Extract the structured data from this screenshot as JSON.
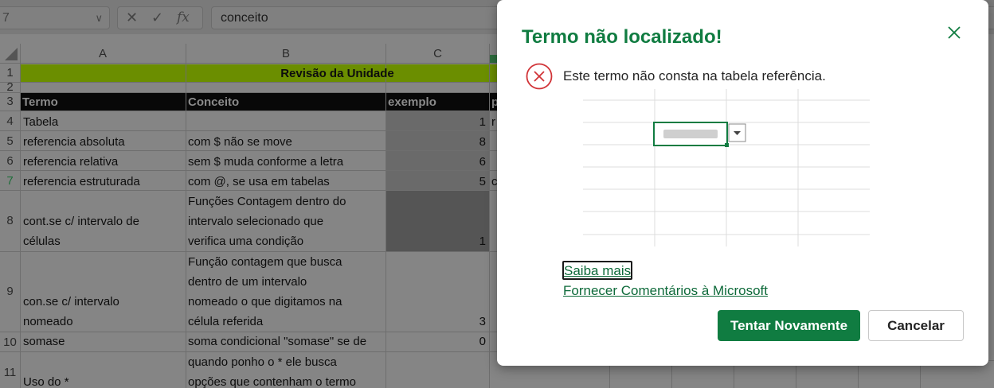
{
  "formula_bar": {
    "name_box_value": "7",
    "cancel_symbol": "✕",
    "enter_symbol": "✓",
    "function_symbol": "fx",
    "formula_text": "conceito"
  },
  "sheet": {
    "columns": [
      "A",
      "B",
      "C"
    ],
    "title_row": "Revisão da Unidade",
    "headers": [
      "Termo",
      "Conceito",
      "exemplo",
      "p"
    ],
    "row_numbers": [
      "1",
      "2",
      "3",
      "4",
      "5",
      "6",
      "7",
      "8",
      "9",
      "10",
      "11"
    ],
    "rows": [
      {
        "a": [
          "Tabela"
        ],
        "b": [],
        "c": "1",
        "d": "r"
      },
      {
        "a": [
          "referencia absoluta"
        ],
        "b": [
          "com $ não se move"
        ],
        "c": "8",
        "d": ""
      },
      {
        "a": [
          "referencia relativa"
        ],
        "b": [
          "sem $ muda conforme a letra"
        ],
        "c": "6",
        "d": ""
      },
      {
        "a": [
          "referencia estruturada"
        ],
        "b": [
          "com @, se usa em tabelas"
        ],
        "c": "5",
        "d": "c"
      },
      {
        "a": [
          "cont.se c/ intervalo de",
          "células"
        ],
        "b": [
          "Funções Contagem dentro do",
          "intervalo selecionado que",
          "verifica uma condição"
        ],
        "c": "1",
        "d": ""
      },
      {
        "a": [
          "con.se c/ intervalo",
          "nomeado"
        ],
        "b": [
          "Função contagem que busca",
          "dentro de um intervalo",
          "nomeado o que digitamos na",
          "célula referida"
        ],
        "c": "3",
        "d": ""
      },
      {
        "a": [
          "somase"
        ],
        "b": [
          "soma condicional \"somase\" se de"
        ],
        "c": "0",
        "d": ""
      },
      {
        "a": [
          "Uso do *"
        ],
        "b": [
          "quando ponho o * ele busca",
          "opções que contenham o termo"
        ],
        "c": "",
        "d": ""
      }
    ]
  },
  "dialog": {
    "title": "Termo não localizado!",
    "message": "Este termo não consta na tabela referência.",
    "links": [
      "Saiba mais",
      "Fornecer Comentários à Microsoft"
    ],
    "retry_label": "Tentar Novamente",
    "cancel_label": "Cancelar",
    "accent_color": "#107c41",
    "error_color": "#d13438"
  }
}
